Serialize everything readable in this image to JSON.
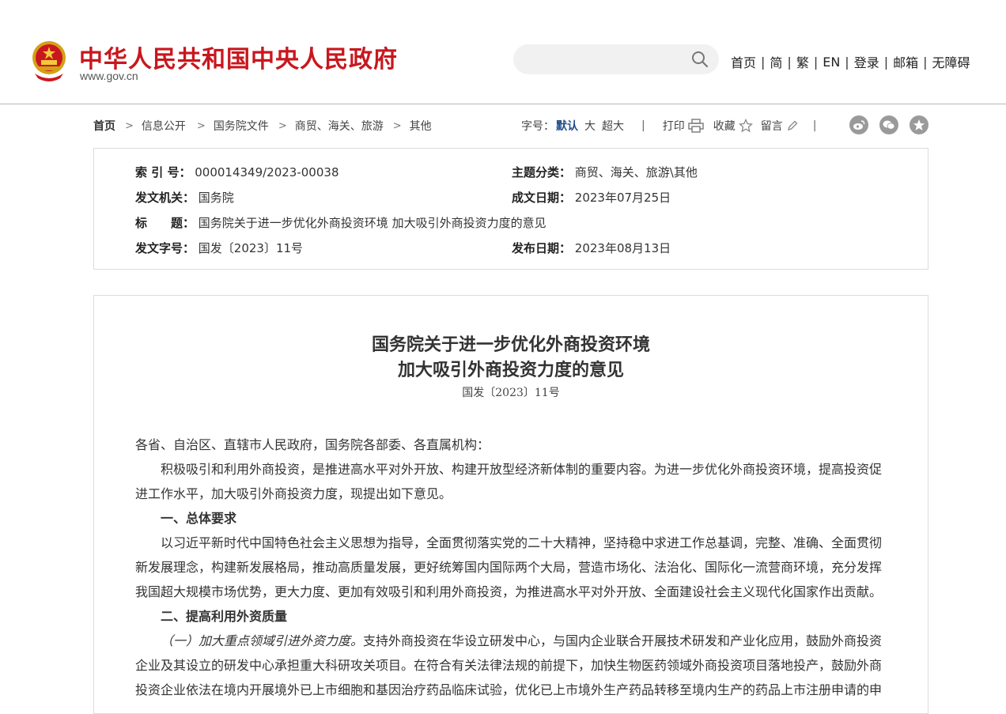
{
  "header": {
    "site_title": "中华人民共和国中央人民政府",
    "site_url": "www.gov.cn",
    "search_placeholder": "",
    "nav": [
      "首页",
      "简",
      "繁",
      "EN",
      "登录",
      "邮箱",
      "无障碍"
    ],
    "nav_separator": "|"
  },
  "breadcrumb": {
    "items": [
      "首页",
      "信息公开",
      "国务院文件",
      "商贸、海关、旅游",
      "其他"
    ],
    "separator": ">"
  },
  "tools": {
    "font_label": "字号：",
    "font_default": "默认",
    "font_large": "大",
    "font_xlarge": "超大",
    "print": "打印",
    "favorite": "收藏",
    "comment": "留言",
    "bar": "|",
    "share_icons": [
      "weibo-icon",
      "wechat-icon",
      "qzone-icon"
    ]
  },
  "meta": {
    "index_label": "索 引 号：",
    "index_value": "000014349/2023-00038",
    "topic_label": "主题分类：",
    "topic_value": "商贸、海关、旅游\\其他",
    "issuer_label": "发文机关：",
    "issuer_value": "国务院",
    "created_label": "成文日期：",
    "created_value": "2023年07月25日",
    "title_label": "标　　题：",
    "title_value": "国务院关于进一步优化外商投资环境 加大吸引外商投资力度的意见",
    "docno_label": "发文字号：",
    "docno_value": "国发〔2023〕11号",
    "published_label": "发布日期：",
    "published_value": "2023年08月13日"
  },
  "article": {
    "title_line1": "国务院关于进一步优化外商投资环境",
    "title_line2": "加大吸引外商投资力度的意见",
    "doc_number": "国发〔2023〕11号",
    "salutation": "各省、自治区、直辖市人民政府，国务院各部委、各直属机构：",
    "para1": "积极吸引和利用外商投资，是推进高水平对外开放、构建开放型经济新体制的重要内容。为进一步优化外商投资环境，提高投资促进工作水平，加大吸引外商投资力度，现提出如下意见。",
    "heading1": "一、总体要求",
    "para2": "以习近平新时代中国特色社会主义思想为指导，全面贯彻落实党的二十大精神，坚持稳中求进工作总基调，完整、准确、全面贯彻新发展理念，构建新发展格局，推动高质量发展，更好统筹国内国际两个大局，营造市场化、法治化、国际化一流营商环境，充分发挥我国超大规模市场优势，更大力度、更加有效吸引和利用外商投资，为推进高水平对外开放、全面建设社会主义现代化国家作出贡献。",
    "heading2": "二、提高利用外资质量",
    "sub1_label": "（一）加大重点领域引进外资力度。",
    "sub1_text": "支持外商投资在华设立研发中心，与国内企业联合开展技术研发和产业化应用，鼓励外商投资企业及其设立的研发中心承担重大科研攻关项目。在符合有关法律法规的前提下，加快生物医药领域外商投资项目落地投产，鼓励外商投资企业依法在境内开展境外已上市细胞和基因治疗药品临床试验，优化已上市境外生产药品转移至境内生产的药品上市注册申请的申"
  }
}
